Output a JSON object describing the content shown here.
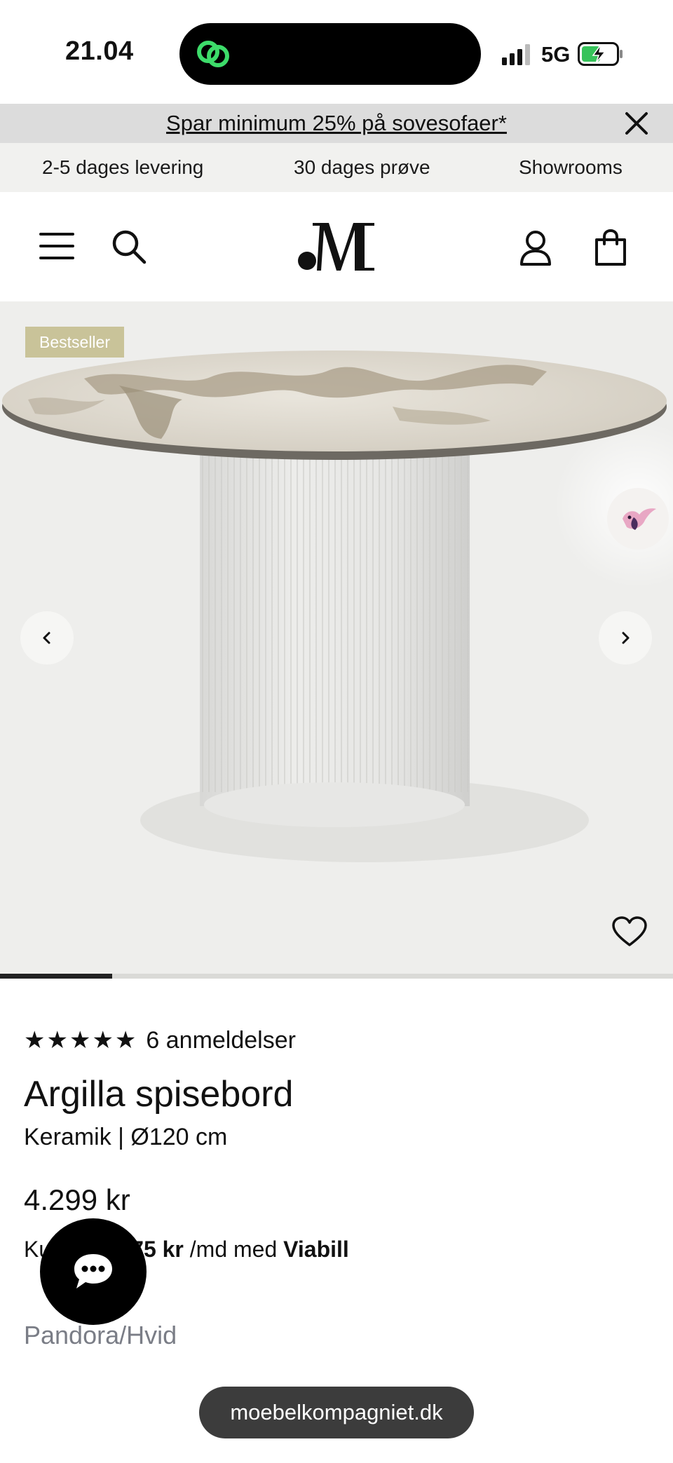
{
  "status": {
    "time": "21.04",
    "network": "5G"
  },
  "promo": {
    "text": "Spar minimum 25% på sovesofaer*"
  },
  "usp": [
    "2-5 dages levering",
    "30 dages prøve",
    "Showrooms"
  ],
  "gallery": {
    "badge": "Bestseller",
    "slide_progress": 0.167
  },
  "product": {
    "rating_stars": "★★★★★",
    "reviews": "6 anmeldelser",
    "title": "Argilla spisebord",
    "subtitle": "Keramik | Ø120 cm",
    "price": "4.299 kr",
    "installment_prefix": "Ku",
    "installment_amount": "75 kr",
    "installment_mid": " /md med ",
    "installment_provider": "Viabill",
    "variant": "Pandora/Hvid"
  },
  "browser": {
    "url": "moebelkompagniet.dk"
  },
  "colors": {
    "badge": "#c9c399",
    "promo_bg": "#dcdcdc",
    "usp_bg": "#f1f1ef",
    "gallery_bg": "#eeeeec"
  }
}
